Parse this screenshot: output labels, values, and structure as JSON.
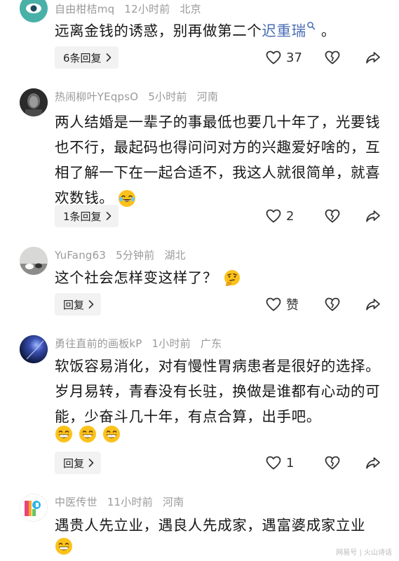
{
  "comments": [
    {
      "username": "自由柑桔mq",
      "time": "12小时前",
      "location": "北京",
      "text_before_link": "远离金钱的诱惑，别再做第二个",
      "link_text": "迟重瑞",
      "text_after_link": " 。",
      "reply_label": "6条回复",
      "likes": "37"
    },
    {
      "username": "热闹柳叶YEqpsO",
      "time": "5小时前",
      "location": "河南",
      "text": "两人结婚是一辈子的事最低也要几十年了，光要钱也不行，最起码也得问问对方的兴趣爱好啥的，互相了解一下在一起合适不，我这人就很简单，就喜欢数钱。",
      "reply_label": "1条回复",
      "likes": "2"
    },
    {
      "username": "YuFang63",
      "time": "5分钟前",
      "location": "湖北",
      "text": "这个社会怎样变这样了？",
      "reply_label": "回复",
      "likes": "赞"
    },
    {
      "username": "勇往直前的画板kP",
      "time": "1小时前",
      "location": "广东",
      "text": "软饭容易消化，对有慢性胃病患者是很好的选择。岁月易转，青春没有长驻，换做是谁都有心动的可能，少奋斗几十年，有点合算，出手吧。",
      "reply_label": "回复",
      "likes": "1"
    },
    {
      "username": "中医传世",
      "time": "11小时前",
      "location": "河南",
      "text": "遇贵人先立业，遇良人先成家，遇富婆成家立业"
    }
  ],
  "watermark": "网易号 | 火山诗话",
  "colors": {
    "link": "#4a6db5",
    "meta": "#9a9a9a",
    "reply_bg": "#f2f2f2"
  },
  "icons": {
    "like": "heart-icon",
    "dislike": "broken-heart-icon",
    "share": "share-arrow-icon",
    "reply_chevron": "chevron-right-icon",
    "laugh_emoji": "tears-of-joy-emoji",
    "grin_emoji": "grin-emoji",
    "think_emoji": "thinking-emoji"
  }
}
